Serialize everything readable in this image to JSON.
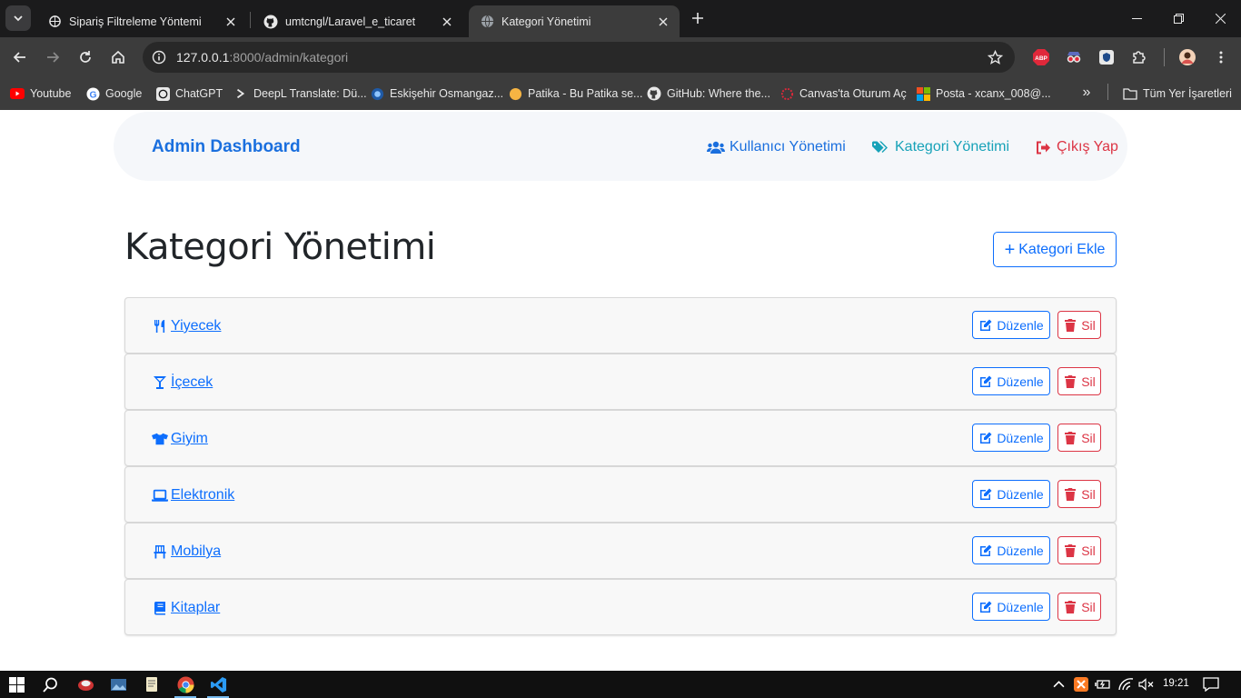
{
  "browser": {
    "tabs": [
      {
        "title": "Sipariş Filtreleme Yöntemi",
        "active": false,
        "favicon": "openai-icon"
      },
      {
        "title": "umtcngl/Laravel_e_ticaret",
        "active": false,
        "favicon": "github-icon"
      },
      {
        "title": "Kategori Yönetimi",
        "active": true,
        "favicon": "globe-icon"
      }
    ],
    "url": {
      "host": "127.0.0.1",
      "rest": ":8000/admin/kategori"
    },
    "bookmarks": [
      {
        "label": "Youtube",
        "icon": "youtube-icon"
      },
      {
        "label": "Google",
        "icon": "google-icon"
      },
      {
        "label": "ChatGPT",
        "icon": "openai-icon"
      },
      {
        "label": "DeepL Translate: Dü...",
        "icon": "deepl-icon"
      },
      {
        "label": "Eskişehir Osmangaz...",
        "icon": "ogu-icon"
      },
      {
        "label": "Patika - Bu Patika se...",
        "icon": "patika-icon"
      },
      {
        "label": "GitHub: Where the...",
        "icon": "github-icon"
      },
      {
        "label": "Canvas'ta Oturum Aç",
        "icon": "canvas-icon"
      },
      {
        "label": "Posta - xcanx_008@...",
        "icon": "microsoft-icon"
      }
    ],
    "bookmarks_folder": "Tüm Yer İşaretleri",
    "extension_badge": "ABP"
  },
  "navbar": {
    "brand": "Admin Dashboard",
    "links": [
      {
        "label": "Kullanıcı Yönetimi",
        "icon": "users-icon",
        "color": "#1a6fde"
      },
      {
        "label": "Kategori Yönetimi",
        "icon": "tags-icon",
        "color": "#17a2b8"
      },
      {
        "label": "Çıkış Yap",
        "icon": "sign-out-icon",
        "color": "#dc3545"
      }
    ]
  },
  "main": {
    "title": "Kategori Yönetimi",
    "add_button": "Kategori Ekle",
    "categories": [
      {
        "name": "Yiyecek",
        "icon": "utensils-icon"
      },
      {
        "name": "İçecek",
        "icon": "cocktail-icon"
      },
      {
        "name": "Giyim",
        "icon": "tshirt-icon"
      },
      {
        "name": "Elektronik",
        "icon": "laptop-icon"
      },
      {
        "name": "Mobilya",
        "icon": "chair-icon"
      },
      {
        "name": "Kitaplar",
        "icon": "book-icon"
      }
    ],
    "edit_label": "Düzenle",
    "delete_label": "Sil"
  },
  "taskbar": {
    "time": "19:21"
  },
  "colors": {
    "primary": "#0d6efd",
    "danger": "#dc3545",
    "info": "#17a2b8",
    "brand": "#1a6fde"
  }
}
